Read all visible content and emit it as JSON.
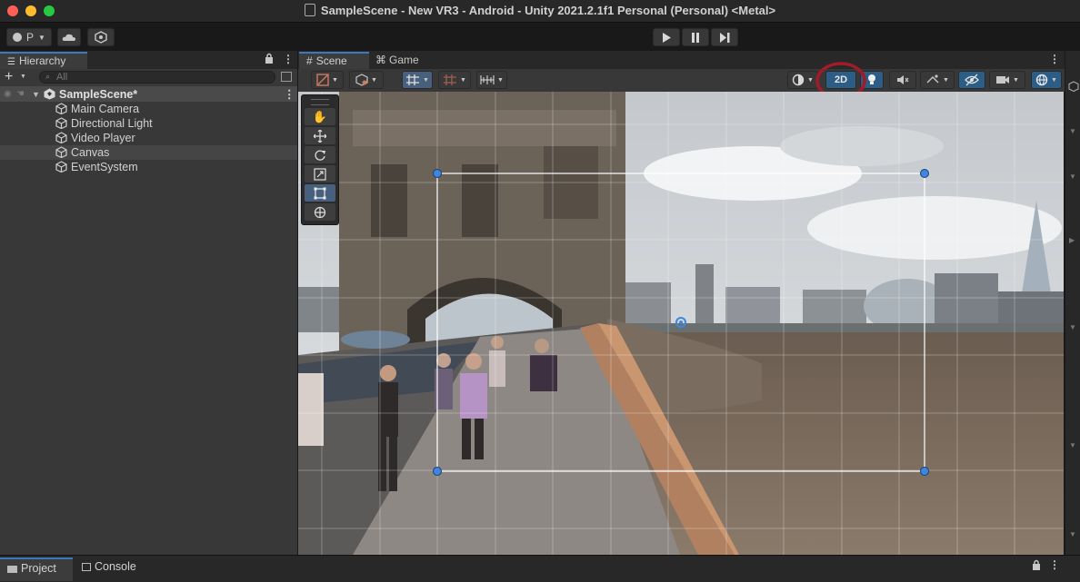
{
  "window": {
    "title": "SampleScene - New VR3 - Android - Unity 2021.2.1f1 Personal (Personal) <Metal>"
  },
  "toolbar": {
    "account_label": "P"
  },
  "hierarchy": {
    "tab_label": "Hierarchy",
    "search_placeholder": "All",
    "scene_name": "SampleScene*",
    "items": [
      {
        "label": "Main Camera"
      },
      {
        "label": "Directional Light"
      },
      {
        "label": "Video Player"
      },
      {
        "label": "Canvas",
        "selected_hover": true
      },
      {
        "label": "EventSystem"
      }
    ]
  },
  "scene_view": {
    "tabs": [
      {
        "label": "Scene",
        "active": true
      },
      {
        "label": "Game",
        "active": false
      }
    ],
    "mode_2d_label": "2D"
  },
  "bottom_panel": {
    "tabs": [
      {
        "label": "Project"
      },
      {
        "label": "Console"
      }
    ]
  },
  "colors": {
    "accent": "#3a79bb",
    "highlight_circle": "#a01c28",
    "panel": "#383838",
    "background": "#191919"
  }
}
